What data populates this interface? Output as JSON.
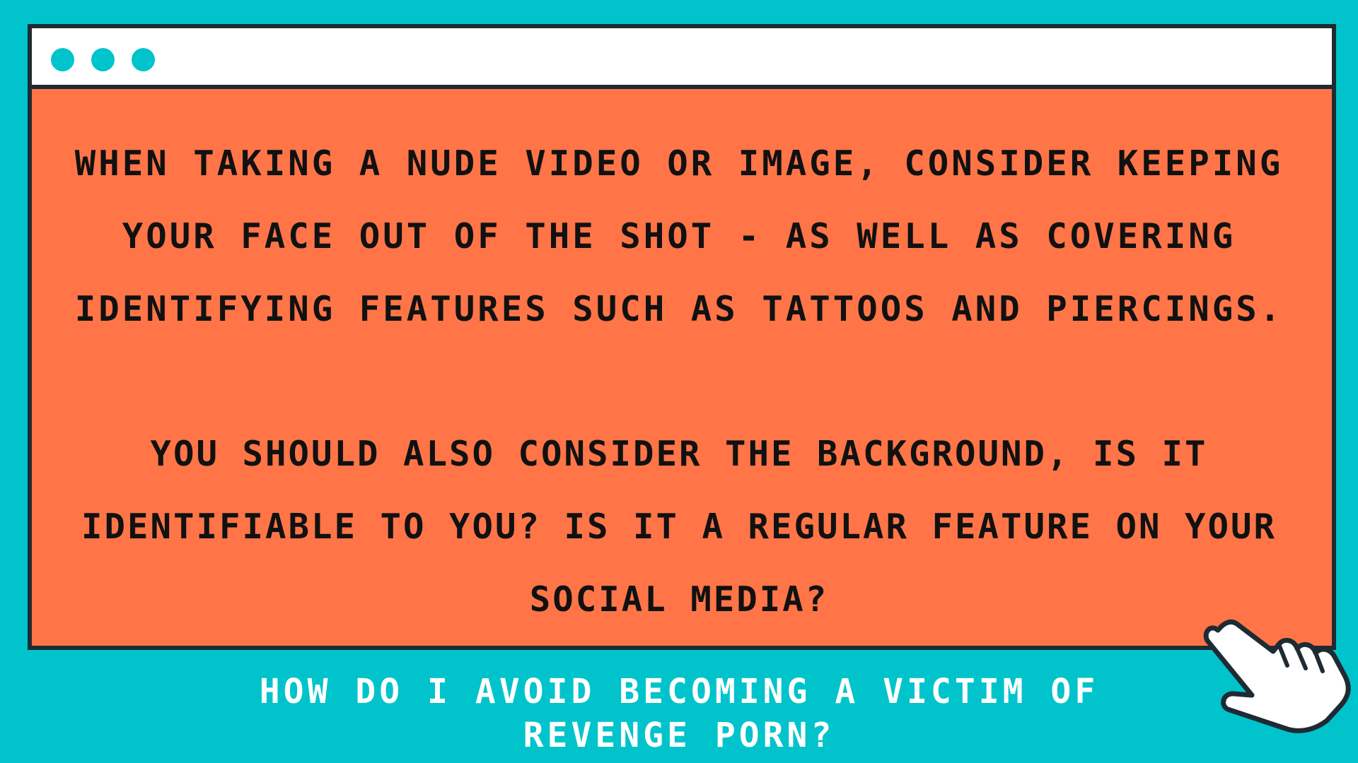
{
  "window": {
    "titlebar_dots": [
      "dot",
      "dot",
      "dot"
    ],
    "paragraph_1": "WHEN TAKING A NUDE VIDEO OR IMAGE, CONSIDER KEEPING YOUR FACE OUT OF THE SHOT - AS WELL AS COVERING IDENTIFYING FEATURES SUCH AS TATTOOS AND PIERCINGS.",
    "paragraph_2": "YOU SHOULD ALSO CONSIDER THE BACKGROUND, IS IT IDENTIFIABLE TO YOU? IS IT A REGULAR FEATURE ON YOUR SOCIAL MEDIA?"
  },
  "caption": {
    "line_1": "HOW DO I AVOID BECOMING A VICTIM OF",
    "line_2": "REVENGE PORN?"
  },
  "icons": {
    "cursor": "pointing-hand-cursor-icon"
  },
  "colors": {
    "background": "#00C3CB",
    "window_fill": "#FF7548",
    "titlebar": "#FFFFFF",
    "border": "#1E2B33",
    "body_text": "#111111",
    "caption_text": "#FFFFFF"
  }
}
